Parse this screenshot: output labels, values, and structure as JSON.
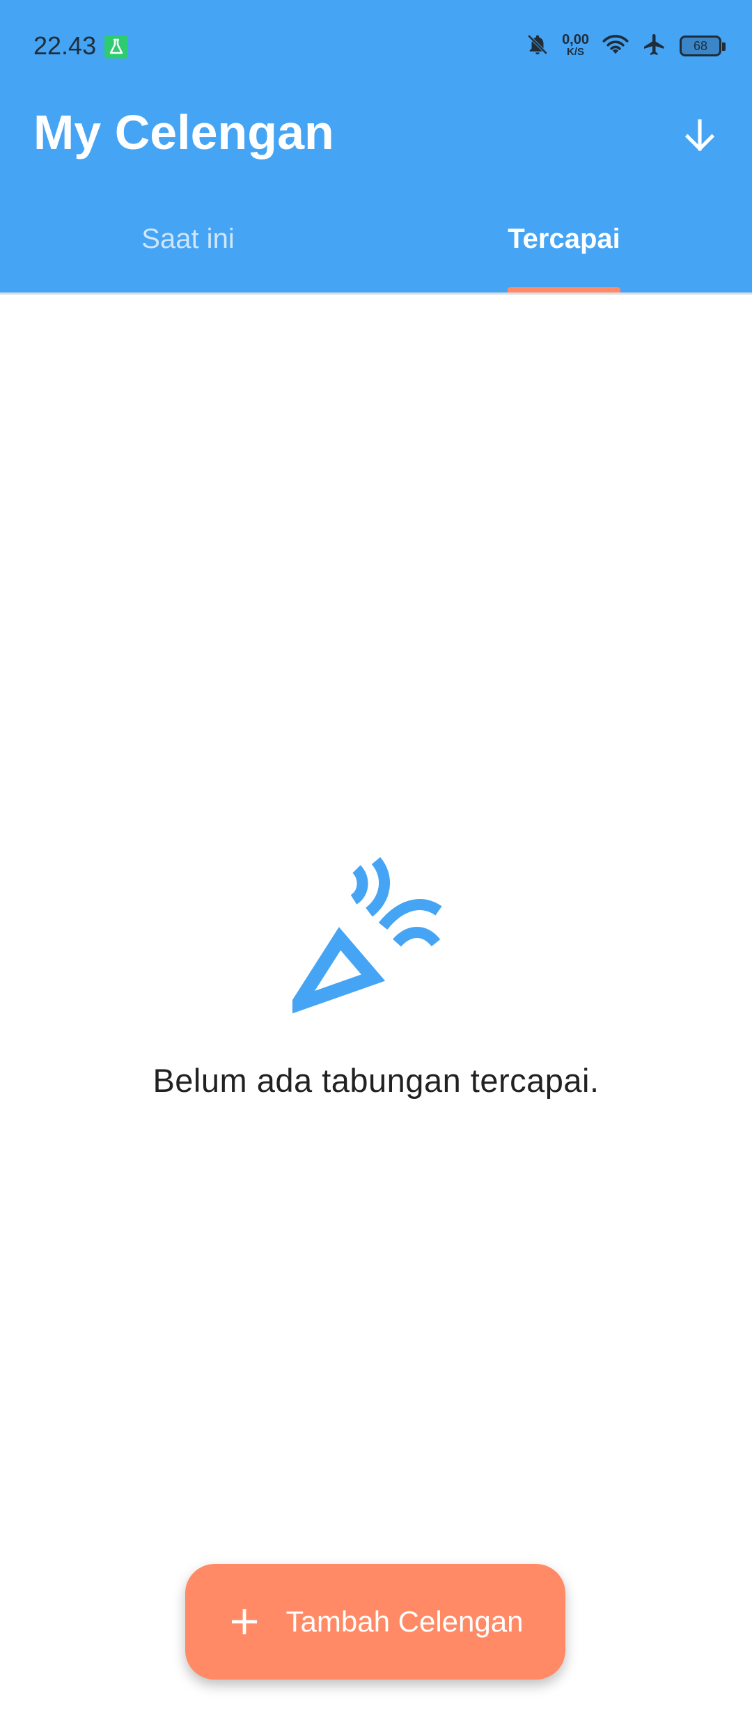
{
  "status_bar": {
    "time": "22.43",
    "net_speed_value": "0,00",
    "net_speed_unit": "K/S",
    "battery_level": "68",
    "icons": [
      "lab-app-icon",
      "bell-off-icon",
      "wifi-icon",
      "airplane-icon",
      "battery-icon"
    ]
  },
  "app_bar": {
    "title": "My Celengan",
    "action_icon": "arrow-down-icon"
  },
  "tabs": [
    {
      "label": "Saat ini",
      "active": false
    },
    {
      "label": "Tercapai",
      "active": true
    }
  ],
  "empty_state": {
    "icon": "party-popper-icon",
    "message": "Belum ada tabungan tercapai."
  },
  "fab": {
    "icon": "plus-icon",
    "label": "Tambah Celengan"
  },
  "colors": {
    "primary": "#45A4F4",
    "accent": "#FF8A65",
    "text_dark": "#212121"
  }
}
